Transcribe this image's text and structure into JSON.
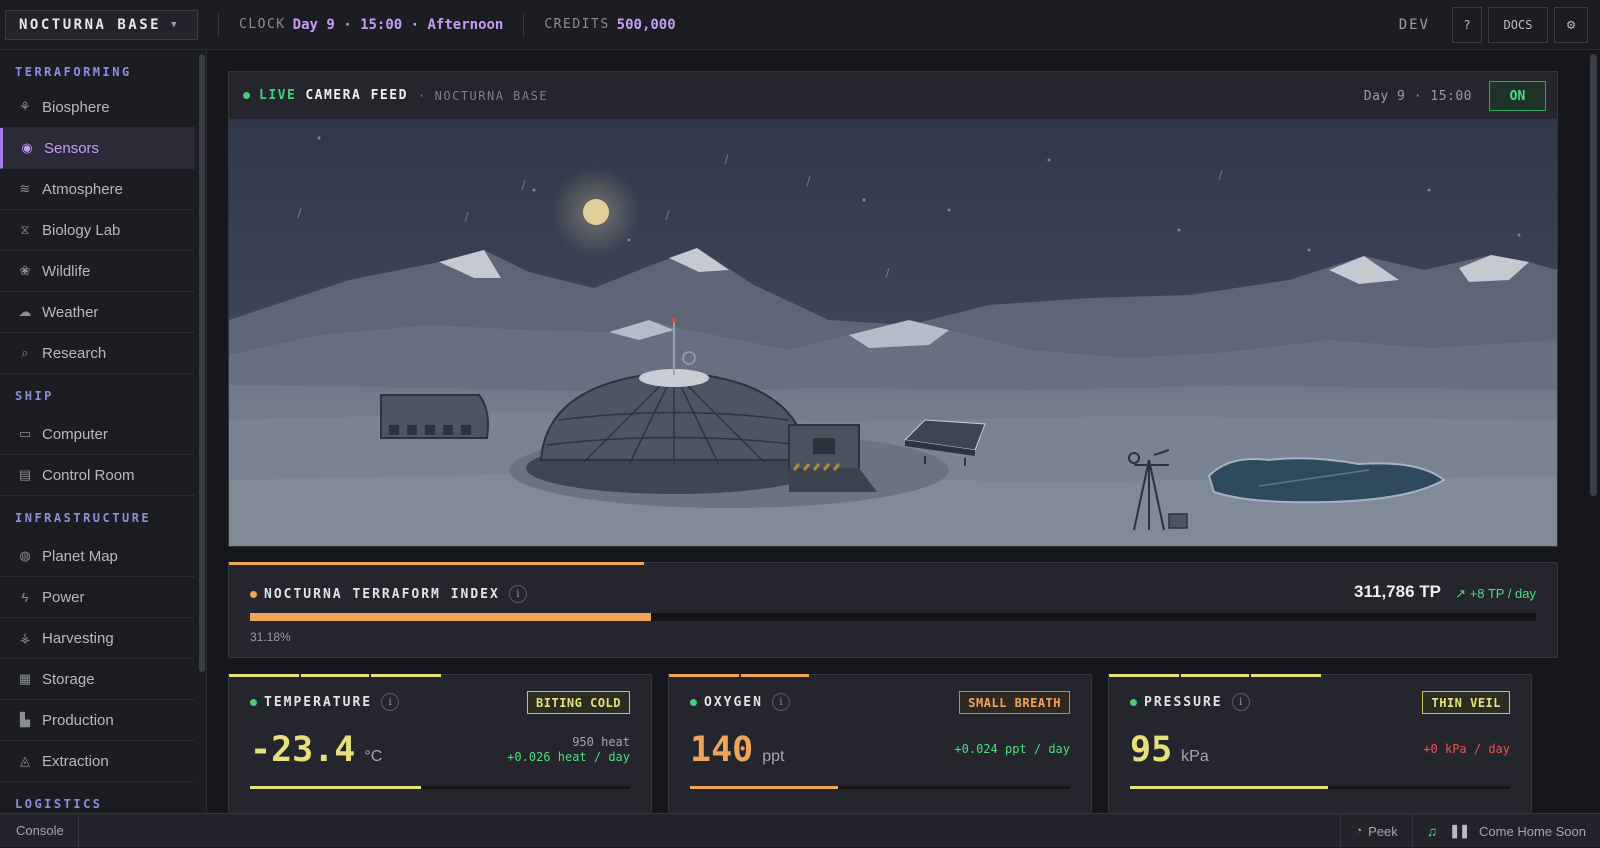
{
  "topbar": {
    "base_name": "NOCTURNA BASE",
    "clock_label": "CLOCK",
    "clock_value": "Day 9 · 15:00 · Afternoon",
    "credits_label": "CREDITS",
    "credits_value": "500,000",
    "dev_label": "DEV",
    "help_label": "?",
    "docs_label": "DOCS",
    "settings_icon": "gear-icon"
  },
  "sidebar": {
    "sections": [
      {
        "title": "TERRAFORMING",
        "items": [
          {
            "label": "Biosphere",
            "icon": "sapling-icon"
          },
          {
            "label": "Sensors",
            "icon": "sensor-icon",
            "active": true
          },
          {
            "label": "Atmosphere",
            "icon": "atmosphere-icon"
          },
          {
            "label": "Biology Lab",
            "icon": "dna-icon"
          },
          {
            "label": "Wildlife",
            "icon": "rabbit-icon"
          },
          {
            "label": "Weather",
            "icon": "cloud-rain-icon"
          },
          {
            "label": "Research",
            "icon": "microscope-icon"
          }
        ]
      },
      {
        "title": "SHIP",
        "items": [
          {
            "label": "Computer",
            "icon": "monitor-icon"
          },
          {
            "label": "Control Room",
            "icon": "dashboard-icon"
          }
        ]
      },
      {
        "title": "INFRASTRUCTURE",
        "items": [
          {
            "label": "Planet Map",
            "icon": "globe-icon"
          },
          {
            "label": "Power",
            "icon": "bolt-icon"
          },
          {
            "label": "Harvesting",
            "icon": "wheat-icon"
          },
          {
            "label": "Storage",
            "icon": "boxes-icon"
          },
          {
            "label": "Production",
            "icon": "factory-icon"
          },
          {
            "label": "Extraction",
            "icon": "drill-icon"
          }
        ]
      },
      {
        "title": "LOGISTICS",
        "items": []
      }
    ]
  },
  "camera": {
    "live_label": "LIVE",
    "title": "CAMERA FEED",
    "subtitle": "NOCTURNA BASE",
    "time": "Day 9 · 15:00",
    "toggle_label": "ON"
  },
  "terraform": {
    "title": "NOCTURNA TERRAFORM INDEX",
    "value": "311,786 TP",
    "rate": "+8 TP / day",
    "percent_label": "31.18%",
    "progress": 0.3118,
    "color": "#f0a45a"
  },
  "metrics": [
    {
      "title": "TEMPERATURE",
      "badge": "BITING COLD",
      "value": "-23.4",
      "unit": "°C",
      "rate_primary": "950 heat",
      "rate_secondary": "+0.026 heat / day",
      "color": "#e8e07a",
      "rate_color": "#4ade80",
      "progress": 0.45
    },
    {
      "title": "OXYGEN",
      "badge": "SMALL BREATH",
      "value": "140",
      "unit": "ppt",
      "rate_primary": "",
      "rate_secondary": "+0.024 ppt / day",
      "color": "#f0a45a",
      "rate_color": "#4ade80",
      "progress": 0.39
    },
    {
      "title": "PRESSURE",
      "badge": "THIN VEIL",
      "value": "95",
      "unit": "kPa",
      "rate_primary": "",
      "rate_secondary": "+0 kPa / day",
      "color": "#e8e07a",
      "rate_color": "#f05252",
      "progress": 0.52
    }
  ],
  "footer": {
    "console_label": "Console",
    "peek_label": "Peek",
    "track_name": "Come Home Soon"
  },
  "colors": {
    "accent_purple": "#c69cf5",
    "live_green": "#42d17a"
  }
}
